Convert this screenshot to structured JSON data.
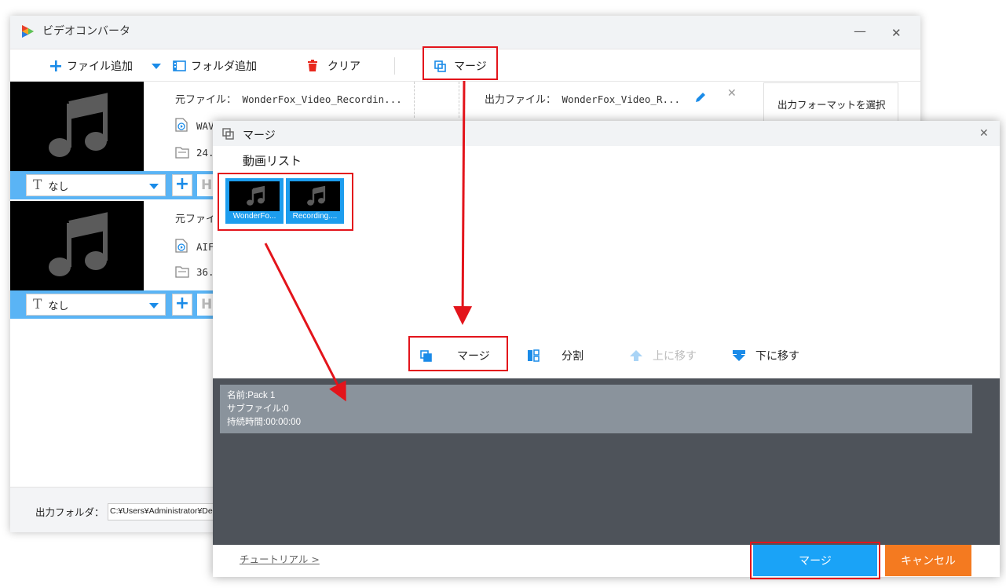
{
  "app": {
    "title": "ビデオコンバータ",
    "minimize_glyph": "—",
    "close_glyph": "✕"
  },
  "toolbar": {
    "add_file_label": "ファイル追加",
    "add_folder_label": "フォルダ追加",
    "clear_label": "クリア",
    "merge_label": "マージ"
  },
  "files": [
    {
      "source_label": "元ファイル：",
      "source_name": "WonderFox_Video_Recordin...",
      "output_label": "出力ファイル：",
      "output_name": "WonderFox_Video_R...",
      "format": "WAV",
      "size": "24.",
      "subtitle": "なし"
    },
    {
      "source_label": "元ファイ",
      "format": "AIF",
      "size": "36.",
      "subtitle": "なし"
    }
  ],
  "right_panel": {
    "format_title": "出力フォーマットを選択"
  },
  "bottom": {
    "output_folder_label": "出力フォルダ：",
    "output_folder_path": "C:¥Users¥Administrator¥De"
  },
  "merge_dialog": {
    "title": "マージ",
    "close_glyph": "✕",
    "video_list_label": "動画リスト",
    "videos": [
      {
        "name": "WonderFo..."
      },
      {
        "name": "Recording...."
      }
    ],
    "actions": {
      "merge_label": "マージ",
      "split_label": "分割",
      "move_up_label": "上に移す",
      "move_down_label": "下に移す"
    },
    "pack": {
      "name_line": "名前:Pack 1",
      "subfile_line": "サブファイル:0",
      "duration_line": "持続時間:00:00:00"
    },
    "tutorial_link": "チュートリアル >",
    "merge_button": "マージ",
    "cancel_button": "キャンセル"
  },
  "colors": {
    "accent_blue": "#1c9dee",
    "merge_button": "#1aa3f7",
    "cancel_button": "#f47a20",
    "highlight_red": "#e3141b",
    "pack_area": "#4e535a",
    "pack_item": "#8a939c"
  },
  "icons": [
    "app-logo-icon",
    "plus-icon",
    "dropdown-icon",
    "film-folder-icon",
    "trash-icon",
    "merge-icon",
    "music-note-icon",
    "pencil-icon",
    "close-icon",
    "play-file-icon",
    "folder-icon",
    "text-t-icon",
    "split-icon",
    "arrow-up-icon",
    "arrow-down-icon"
  ]
}
